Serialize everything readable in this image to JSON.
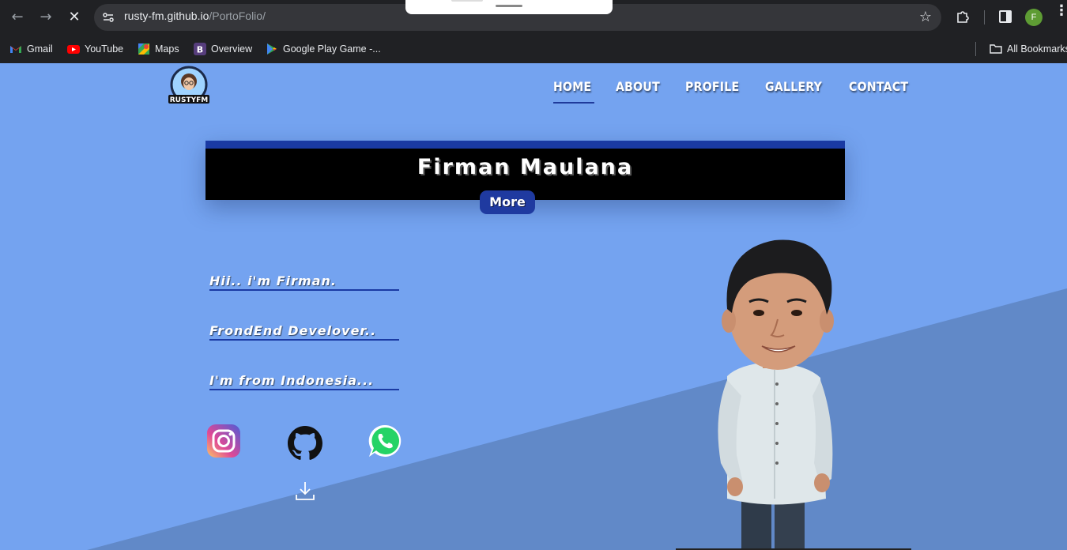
{
  "browser": {
    "url_host": "rusty-fm.github.io",
    "url_path": "/PortoFolio/",
    "profile_initial": "F",
    "bookmarks": [
      {
        "label": "Gmail",
        "icon": "gmail-icon"
      },
      {
        "label": "YouTube",
        "icon": "youtube-icon"
      },
      {
        "label": "Maps",
        "icon": "maps-icon"
      },
      {
        "label": "Overview",
        "icon": "bootstrap-icon"
      },
      {
        "label": "Google Play Game -...",
        "icon": "play-games-icon"
      }
    ],
    "all_bookmarks_label": "All Bookmarks"
  },
  "site": {
    "logo_text": "RUSTYFM",
    "nav": [
      {
        "label": "HOME",
        "active": true
      },
      {
        "label": "ABOUT",
        "active": false
      },
      {
        "label": "PROFILE",
        "active": false
      },
      {
        "label": "GALLERY",
        "active": false
      },
      {
        "label": "CONTACT",
        "active": false
      }
    ],
    "banner_title": "Firman Maulana",
    "more_label": "More",
    "intro_lines": [
      "Hii.. i'm Firman.",
      "FrondEnd Develover..",
      "I'm from Indonesia..."
    ],
    "social": [
      {
        "icon": "instagram-icon"
      },
      {
        "icon": "github-icon"
      },
      {
        "icon": "whatsapp-icon"
      }
    ],
    "colors": {
      "background": "#74a3f0",
      "diagonal": "#6189c8",
      "accent": "#1a3aa3",
      "banner": "#000000"
    }
  }
}
